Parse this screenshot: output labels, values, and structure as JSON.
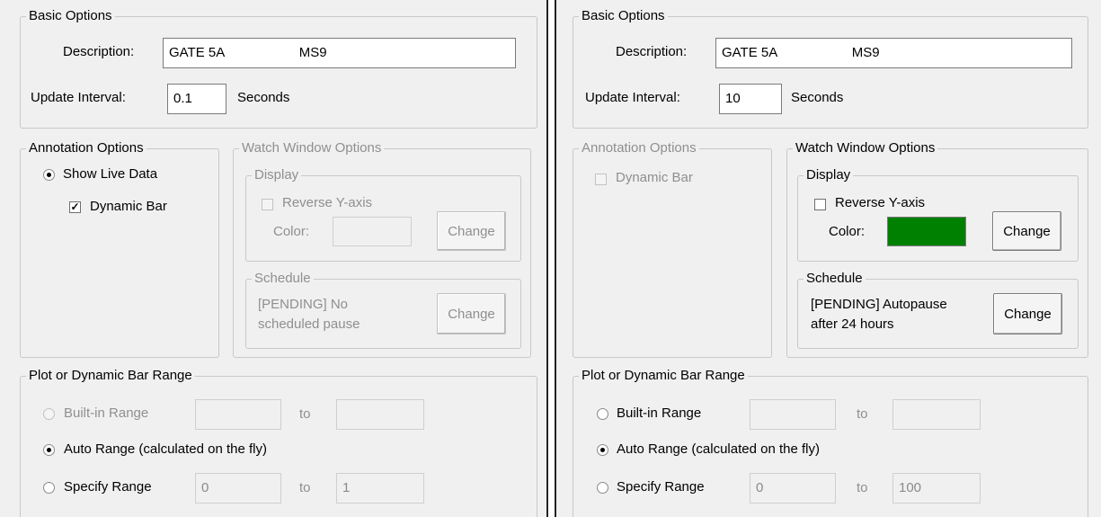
{
  "panels": [
    {
      "basic_options": {
        "title": "Basic Options",
        "description_label": "Description:",
        "description_value": "GATE 5A                    MS9",
        "update_interval_label": "Update Interval:",
        "update_interval_value": "0.1",
        "seconds_label": "Seconds"
      },
      "annotation_options": {
        "title": "Annotation Options",
        "show_live_data_label": "Show Live Data",
        "show_live_data_selected": true,
        "dynamic_bar_label": "Dynamic Bar",
        "dynamic_bar_checked": true,
        "enabled": true
      },
      "watch_window_options": {
        "title": "Watch Window Options",
        "enabled": false,
        "display_title": "Display",
        "reverse_y_label": "Reverse Y-axis",
        "reverse_y_checked": false,
        "color_label": "Color:",
        "color_value": "",
        "change_label": "Change",
        "schedule_title": "Schedule",
        "schedule_text_line1": "[PENDING] No",
        "schedule_text_line2": "scheduled pause",
        "schedule_change_label": "Change"
      },
      "plot_range": {
        "title": "Plot or Dynamic Bar Range",
        "builtin_label": "Built-in Range",
        "builtin_enabled": false,
        "builtin_from": "",
        "builtin_to": "",
        "auto_label": "Auto Range (calculated on the fly)",
        "specify_label": "Specify Range",
        "specify_from": "0",
        "specify_to": "1",
        "to_label": "to",
        "selected": "auto"
      }
    },
    {
      "basic_options": {
        "title": "Basic Options",
        "description_label": "Description:",
        "description_value": "GATE 5A                    MS9",
        "update_interval_label": "Update Interval:",
        "update_interval_value": "10",
        "seconds_label": "Seconds"
      },
      "annotation_options": {
        "title": "Annotation Options",
        "dynamic_bar_label": "Dynamic Bar",
        "dynamic_bar_checked": false,
        "enabled": false
      },
      "watch_window_options": {
        "title": "Watch Window Options",
        "enabled": true,
        "display_title": "Display",
        "reverse_y_label": "Reverse Y-axis",
        "reverse_y_checked": false,
        "color_label": "Color:",
        "color_value": "#008000",
        "change_label": "Change",
        "schedule_title": "Schedule",
        "schedule_text_line1": "[PENDING] Autopause",
        "schedule_text_line2": "after 24 hours",
        "schedule_change_label": "Change"
      },
      "plot_range": {
        "title": "Plot or Dynamic Bar Range",
        "builtin_label": "Built-in Range",
        "builtin_enabled": true,
        "builtin_from": "",
        "builtin_to": "",
        "auto_label": "Auto Range (calculated on the fly)",
        "specify_label": "Specify Range",
        "specify_from": "0",
        "specify_to": "100",
        "to_label": "to",
        "selected": "auto"
      }
    }
  ]
}
